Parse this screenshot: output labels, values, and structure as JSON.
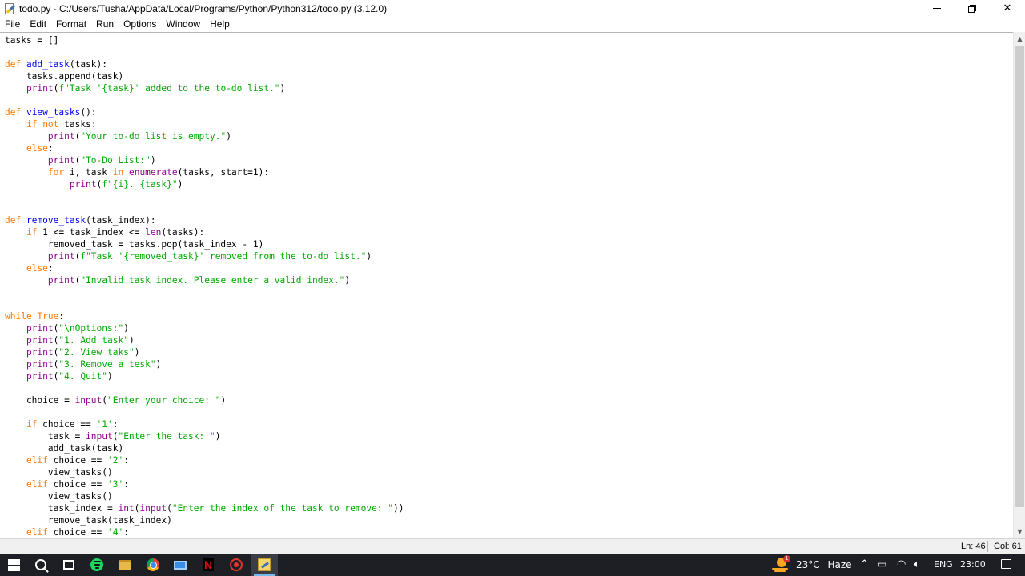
{
  "window": {
    "title": "todo.py - C:/Users/Tusha/AppData/Local/Programs/Python/Python312/todo.py (3.12.0)",
    "minimize": "—",
    "close": "✕"
  },
  "menu": [
    "File",
    "Edit",
    "Format",
    "Run",
    "Options",
    "Window",
    "Help"
  ],
  "code_lines": [
    [
      [
        "tasks = []",
        ""
      ]
    ],
    [],
    [
      [
        "def",
        "kw"
      ],
      [
        " ",
        ""
      ],
      [
        "add_task",
        "df"
      ],
      [
        "(task):",
        ""
      ]
    ],
    [
      [
        "    tasks.append(task)",
        ""
      ]
    ],
    [
      [
        "    ",
        ""
      ],
      [
        "print",
        "bi"
      ],
      [
        "(",
        ""
      ],
      [
        "f\"Task '{task}' added to the to-do list.\"",
        "st"
      ],
      [
        ")",
        ""
      ]
    ],
    [],
    [
      [
        "def",
        "kw"
      ],
      [
        " ",
        ""
      ],
      [
        "view_tasks",
        "df"
      ],
      [
        "():",
        ""
      ]
    ],
    [
      [
        "    ",
        ""
      ],
      [
        "if",
        "kw"
      ],
      [
        " ",
        ""
      ],
      [
        "not",
        "kw"
      ],
      [
        " tasks:",
        ""
      ]
    ],
    [
      [
        "        ",
        ""
      ],
      [
        "print",
        "bi"
      ],
      [
        "(",
        ""
      ],
      [
        "\"Your to-do list is empty.\"",
        "st"
      ],
      [
        ")",
        ""
      ]
    ],
    [
      [
        "    ",
        ""
      ],
      [
        "else",
        "kw"
      ],
      [
        ":",
        ""
      ]
    ],
    [
      [
        "        ",
        ""
      ],
      [
        "print",
        "bi"
      ],
      [
        "(",
        ""
      ],
      [
        "\"To-Do List:\"",
        "st"
      ],
      [
        ")",
        ""
      ]
    ],
    [
      [
        "        ",
        ""
      ],
      [
        "for",
        "kw"
      ],
      [
        " i, task ",
        ""
      ],
      [
        "in",
        "kw"
      ],
      [
        " ",
        ""
      ],
      [
        "enumerate",
        "bi"
      ],
      [
        "(tasks, start=1):",
        ""
      ]
    ],
    [
      [
        "            ",
        ""
      ],
      [
        "print",
        "bi"
      ],
      [
        "(",
        ""
      ],
      [
        "f\"{i}. {task}\"",
        "st"
      ],
      [
        ")",
        ""
      ]
    ],
    [],
    [],
    [
      [
        "def",
        "kw"
      ],
      [
        " ",
        ""
      ],
      [
        "remove_task",
        "df"
      ],
      [
        "(task_index):",
        ""
      ]
    ],
    [
      [
        "    ",
        ""
      ],
      [
        "if",
        "kw"
      ],
      [
        " 1 <= task_index <= ",
        ""
      ],
      [
        "len",
        "bi"
      ],
      [
        "(tasks):",
        ""
      ]
    ],
    [
      [
        "        removed_task = tasks.pop(task_index - 1)",
        ""
      ]
    ],
    [
      [
        "        ",
        ""
      ],
      [
        "print",
        "bi"
      ],
      [
        "(",
        ""
      ],
      [
        "f\"Task '{removed_task}' removed from the to-do list.\"",
        "st"
      ],
      [
        ")",
        ""
      ]
    ],
    [
      [
        "    ",
        ""
      ],
      [
        "else",
        "kw"
      ],
      [
        ":",
        ""
      ]
    ],
    [
      [
        "        ",
        ""
      ],
      [
        "print",
        "bi"
      ],
      [
        "(",
        ""
      ],
      [
        "\"Invalid task index. Please enter a valid index.\"",
        "st"
      ],
      [
        ")",
        ""
      ]
    ],
    [],
    [],
    [
      [
        "while",
        "kw"
      ],
      [
        " ",
        ""
      ],
      [
        "True",
        "kw"
      ],
      [
        ":",
        ""
      ]
    ],
    [
      [
        "    ",
        ""
      ],
      [
        "print",
        "bi"
      ],
      [
        "(",
        ""
      ],
      [
        "\"\\nOptions:\"",
        "st"
      ],
      [
        ")",
        ""
      ]
    ],
    [
      [
        "    ",
        ""
      ],
      [
        "print",
        "bi"
      ],
      [
        "(",
        ""
      ],
      [
        "\"1. Add task\"",
        "st"
      ],
      [
        ")",
        ""
      ]
    ],
    [
      [
        "    ",
        ""
      ],
      [
        "print",
        "bi"
      ],
      [
        "(",
        ""
      ],
      [
        "\"2. View taks\"",
        "st"
      ],
      [
        ")",
        ""
      ]
    ],
    [
      [
        "    ",
        ""
      ],
      [
        "print",
        "bi"
      ],
      [
        "(",
        ""
      ],
      [
        "\"3. Remove a tesk\"",
        "st"
      ],
      [
        ")",
        ""
      ]
    ],
    [
      [
        "    ",
        ""
      ],
      [
        "print",
        "bi"
      ],
      [
        "(",
        ""
      ],
      [
        "\"4. Quit\"",
        "st"
      ],
      [
        ")",
        ""
      ]
    ],
    [],
    [
      [
        "    choice = ",
        ""
      ],
      [
        "input",
        "bi"
      ],
      [
        "(",
        ""
      ],
      [
        "\"Enter your choice: \"",
        "st"
      ],
      [
        ")",
        ""
      ]
    ],
    [],
    [
      [
        "    ",
        ""
      ],
      [
        "if",
        "kw"
      ],
      [
        " choice == ",
        ""
      ],
      [
        "'1'",
        "st"
      ],
      [
        ":",
        ""
      ]
    ],
    [
      [
        "        task = ",
        ""
      ],
      [
        "input",
        "bi"
      ],
      [
        "(",
        ""
      ],
      [
        "\"Enter the task: \"",
        "st"
      ],
      [
        ")",
        ""
      ]
    ],
    [
      [
        "        add_task(task)",
        ""
      ]
    ],
    [
      [
        "    ",
        ""
      ],
      [
        "elif",
        "kw"
      ],
      [
        " choice == ",
        ""
      ],
      [
        "'2'",
        "st"
      ],
      [
        ":",
        ""
      ]
    ],
    [
      [
        "        view_tasks()",
        ""
      ]
    ],
    [
      [
        "    ",
        ""
      ],
      [
        "elif",
        "kw"
      ],
      [
        " choice == ",
        ""
      ],
      [
        "'3'",
        "st"
      ],
      [
        ":",
        ""
      ]
    ],
    [
      [
        "        view_tasks()",
        ""
      ]
    ],
    [
      [
        "        task_index = ",
        ""
      ],
      [
        "int",
        "bi"
      ],
      [
        "(",
        ""
      ],
      [
        "input",
        "bi"
      ],
      [
        "(",
        ""
      ],
      [
        "\"Enter the index of the task to remove: \"",
        "st"
      ],
      [
        "))",
        ""
      ]
    ],
    [
      [
        "        remove_task(task_index)",
        ""
      ]
    ],
    [
      [
        "    ",
        ""
      ],
      [
        "elif",
        "kw"
      ],
      [
        " choice == ",
        ""
      ],
      [
        "'4'",
        "st"
      ],
      [
        ":",
        ""
      ]
    ]
  ],
  "status": {
    "line": "Ln: 46",
    "column": "Col: 61"
  },
  "taskbar": {
    "weather_temp": "23°C",
    "weather_desc": "Haze",
    "weather_badge": "1",
    "language": "ENG",
    "clock": "23:00"
  },
  "colors": {
    "keyword": "#ff7700",
    "builtin": "#900090",
    "string": "#00aa00",
    "definition": "#0000ff",
    "taskbar": "#1d1f25"
  }
}
